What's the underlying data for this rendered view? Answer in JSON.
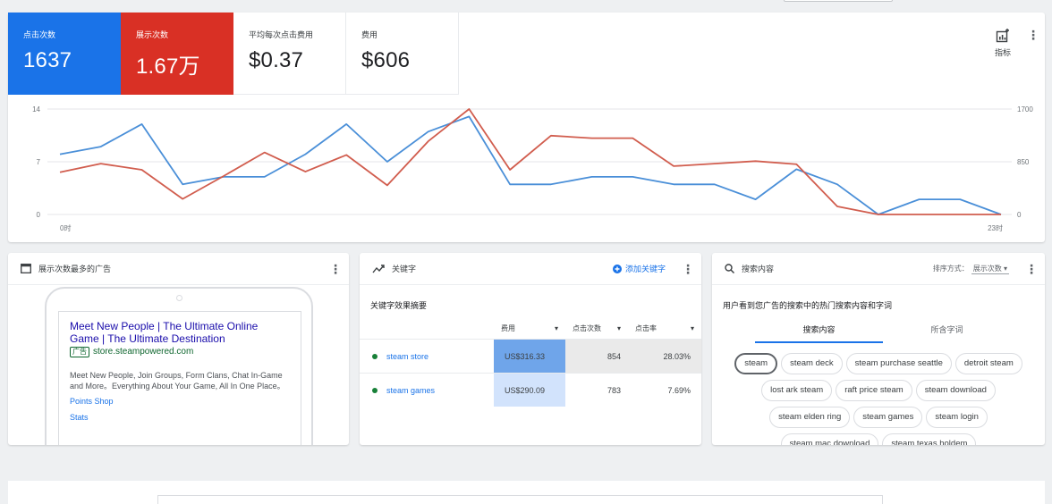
{
  "metrics": [
    {
      "label": "点击次数",
      "value": "1637",
      "color": "#1a73e8"
    },
    {
      "label": "展示次数",
      "value": "1.67万",
      "color": "#d93025"
    },
    {
      "label": "平均每次点击费用",
      "value": "$0.37"
    },
    {
      "label": "费用",
      "value": "$606"
    }
  ],
  "toolbar": {
    "metrics_label": "指标"
  },
  "chart_data": {
    "type": "line",
    "x_start_label": "0时",
    "x_end_label": "23时",
    "y_left": {
      "ticks": [
        "14",
        "7",
        "0"
      ],
      "range": [
        0,
        14
      ]
    },
    "y_right": {
      "ticks": [
        "1700",
        "850",
        "0"
      ],
      "range": [
        0,
        1700
      ]
    },
    "grid": true,
    "series": [
      {
        "color": "#4a8fd8",
        "axis": "left",
        "values": [
          8,
          9,
          12,
          4,
          5,
          5,
          8,
          12,
          7,
          11,
          13,
          4,
          4,
          5,
          5,
          4,
          4,
          2,
          6,
          4,
          0,
          2,
          2,
          0
        ]
      },
      {
        "color": "#d15d4e",
        "axis": "right",
        "values": [
          680,
          820,
          720,
          250,
          620,
          1000,
          690,
          960,
          470,
          1180,
          1700,
          720,
          1270,
          1230,
          1230,
          780,
          820,
          860,
          810,
          130,
          0,
          0,
          0,
          0
        ]
      }
    ]
  },
  "ads_card": {
    "title": "展示次数最多的广告",
    "ad": {
      "headline": "Meet New People | The Ultimate Online Game | The Ultimate Destination",
      "badge": "广告",
      "url": "store.steampowered.com",
      "description": "Meet New People, Join Groups, Form Clans, Chat In-Game and More。Everything About Your Game, All In One Place。",
      "links": [
        "Points Shop",
        "Stats"
      ]
    }
  },
  "keywords_card": {
    "title": "关键字",
    "add_label": "添加关键字",
    "subtitle": "关键字效果摘要",
    "columns": [
      "费用",
      "点击次数",
      "点击率"
    ],
    "rows": [
      {
        "keyword": "steam store",
        "cost": "US$316.33",
        "clicks": "854",
        "ctr": "28.03%",
        "cost_shade": "#6fa5ea"
      },
      {
        "keyword": "steam games",
        "cost": "US$290.09",
        "clicks": "783",
        "ctr": "7.69%",
        "cost_shade": "#d2e3fc"
      }
    ]
  },
  "search_card": {
    "title": "搜索内容",
    "sort_label": "排序方式：",
    "sort_value": "展示次数",
    "description": "用户看到您广告的搜索中的热门搜索内容和字词",
    "tabs": [
      "搜索内容",
      "所含字词"
    ],
    "chips": [
      "steam",
      "steam deck",
      "steam purchase seattle",
      "detroit steam",
      "lost ark steam",
      "raft price steam",
      "steam download",
      "steam elden ring",
      "steam games",
      "steam login",
      "steam mac download",
      "steam texas holdem"
    ]
  }
}
